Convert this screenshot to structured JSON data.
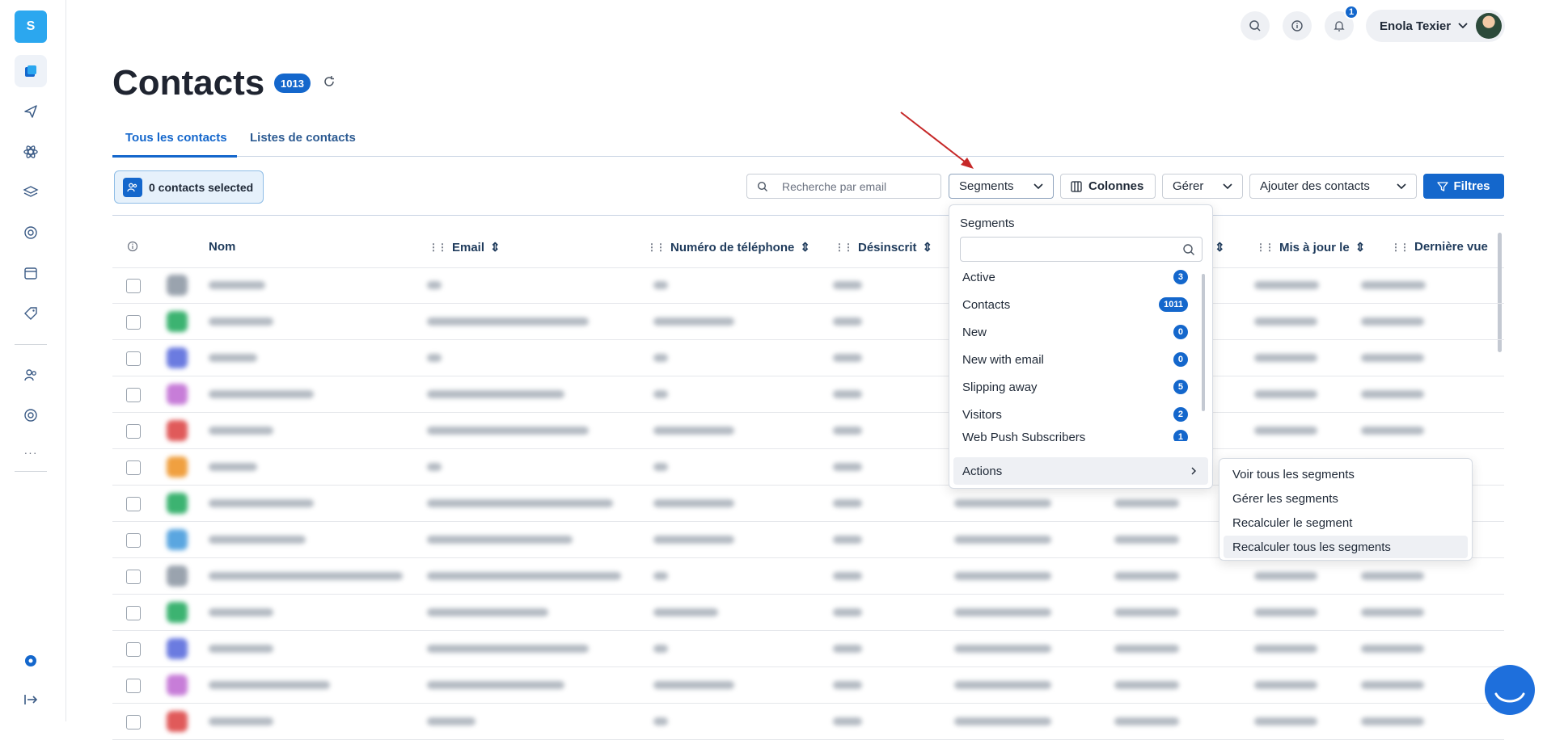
{
  "sidebar": {
    "logo_letter": "S",
    "icons": [
      "dashboard-icon",
      "send-icon",
      "atom-icon",
      "layers-icon",
      "target-icon",
      "calendar-icon",
      "tag-icon",
      "users-icon",
      "support-icon",
      "more-icon",
      "help-icon",
      "logout-icon"
    ],
    "more": "···"
  },
  "topbar": {
    "notification_count": "1",
    "user_name": "Enola Texier"
  },
  "page": {
    "title": "Contacts",
    "count": "1013"
  },
  "tabs": [
    {
      "label": "Tous les contacts",
      "active": true
    },
    {
      "label": "Listes de contacts",
      "active": false
    }
  ],
  "toolbar": {
    "selected_label": "0 contacts selected",
    "search_placeholder": "Recherche par email",
    "segments_label": "Segments",
    "columns_label": "Colonnes",
    "manage_label": "Gérer",
    "add_contacts_label": "Ajouter des contacts",
    "filters_label": "Filtres"
  },
  "table": {
    "columns": [
      "Nom",
      "Email",
      "Numéro de téléphone",
      "Désinscrit",
      "Mis à jour le",
      "Dernière vue"
    ]
  },
  "segments_dropdown": {
    "title": "Segments",
    "items": [
      {
        "label": "Active",
        "count": "3"
      },
      {
        "label": "Contacts",
        "count": "1011"
      },
      {
        "label": "New",
        "count": "0"
      },
      {
        "label": "New with email",
        "count": "0"
      },
      {
        "label": "Slipping away",
        "count": "5"
      },
      {
        "label": "Visitors",
        "count": "2"
      },
      {
        "label": "Web Push Subscribers",
        "count": "1"
      }
    ],
    "actions_label": "Actions"
  },
  "actions_submenu": {
    "items": [
      "Voir tous les segments",
      "Gérer les segments",
      "Recalculer le segment",
      "Recalculer tous les segments"
    ]
  },
  "colors": {
    "primary": "#1467cc",
    "logo": "#2ba7ef",
    "arrow": "#c62828"
  }
}
